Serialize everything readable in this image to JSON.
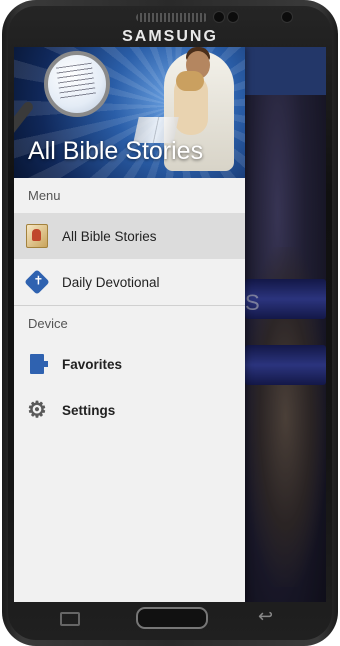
{
  "device": {
    "brand": "SAMSUNG"
  },
  "drawer": {
    "header_title": "All Bible Stories",
    "sections": [
      {
        "title": "Menu",
        "items": [
          {
            "label": "All Bible Stories",
            "icon": "bible-stories-icon",
            "selected": true
          },
          {
            "label": "Daily Devotional",
            "icon": "devotional-icon",
            "selected": false
          }
        ]
      },
      {
        "title": "Device",
        "items": [
          {
            "label": "Favorites",
            "icon": "favorites-icon",
            "selected": false
          },
          {
            "label": "Settings",
            "icon": "gear-icon",
            "selected": false
          }
        ]
      }
    ]
  },
  "background": {
    "partial_text": "S"
  },
  "colors": {
    "drawer_bg": "#f1f1f1",
    "selected_bg": "#dcdcdc",
    "accent_blue": "#2f62b0",
    "appbar": "#2f4a8c"
  }
}
